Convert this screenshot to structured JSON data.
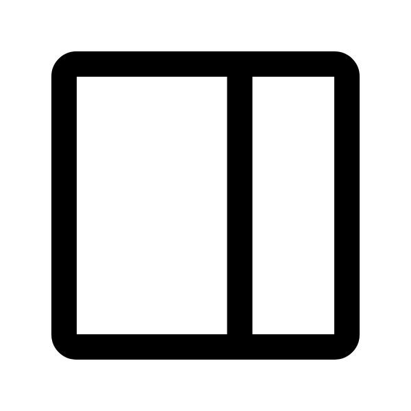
{
  "icon": {
    "name": "sidebar-right-panel-icon",
    "stroke_color": "#000000",
    "fill_color": "#ffffff",
    "background_color": "#ffffff"
  }
}
